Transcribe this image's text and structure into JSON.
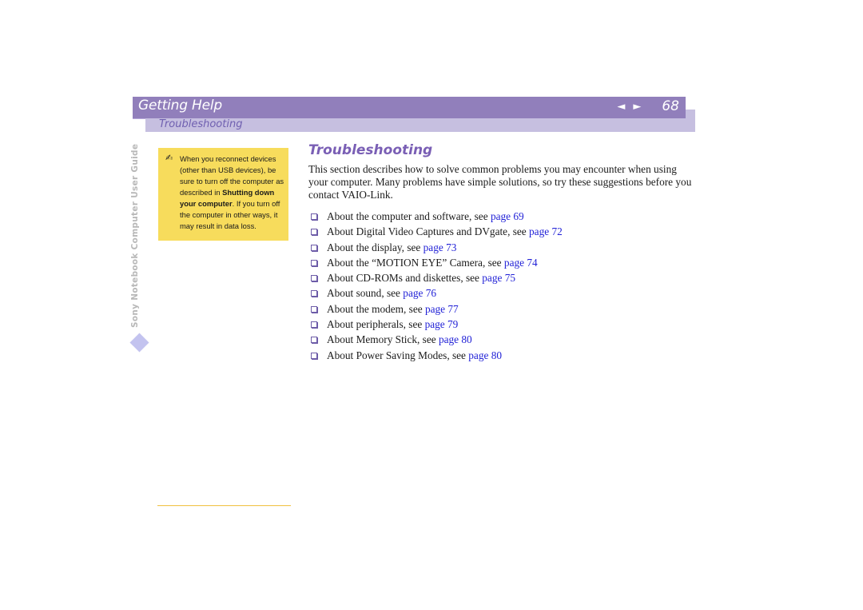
{
  "header": {
    "title": "Getting Help",
    "prev_icon": "◄",
    "next_icon": "►",
    "page_number": "68",
    "section": "Troubleshooting"
  },
  "sidebar": {
    "vertical_label": "Sony Notebook Computer User Guide"
  },
  "note": {
    "icon": "✍",
    "text_before": "When you reconnect devices (other than USB devices), be sure to turn off the computer as described in ",
    "bold_link": "Shutting down your computer",
    "text_after": ". If you turn off the computer in other ways, it may result in data loss."
  },
  "main": {
    "title": "Troubleshooting",
    "intro": "This section describes how to solve common problems you may encounter when using your computer. Many problems have simple solutions, so try these suggestions before you contact VAIO-Link.",
    "items": [
      {
        "text": "About the computer and software, see ",
        "link": "page 69"
      },
      {
        "text": "About Digital Video Captures and DVgate, see ",
        "link": "page 72"
      },
      {
        "text": "About the display, see ",
        "link": "page 73"
      },
      {
        "text": "About the “MOTION EYE” Camera, see ",
        "link": "page 74"
      },
      {
        "text": "About CD-ROMs and diskettes, see ",
        "link": "page 75"
      },
      {
        "text": "About sound, see ",
        "link": "page 76"
      },
      {
        "text": "About the modem, see ",
        "link": "page 77"
      },
      {
        "text": "About peripherals, see ",
        "link": "page 79"
      },
      {
        "text": "About Memory Stick, see ",
        "link": "page 80"
      },
      {
        "text": "About Power Saving Modes, see ",
        "link": "page 80"
      }
    ]
  }
}
